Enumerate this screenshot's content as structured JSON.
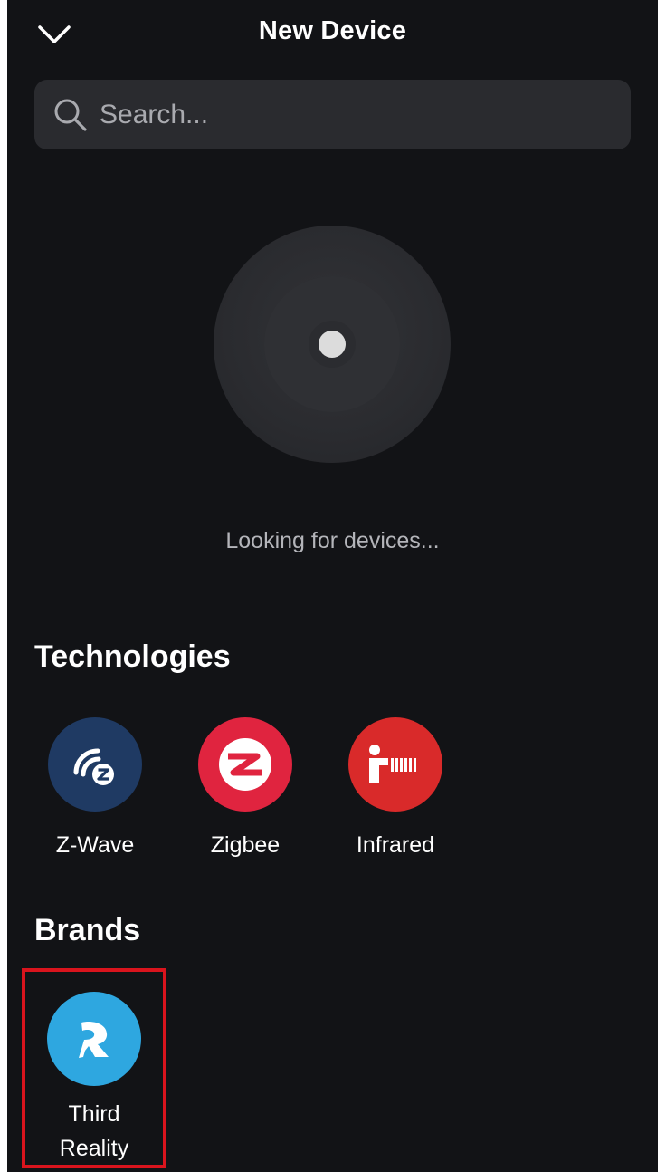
{
  "header": {
    "title": "New Device"
  },
  "search": {
    "placeholder": "Search..."
  },
  "scan": {
    "status_text": "Looking for devices..."
  },
  "technologies": {
    "title": "Technologies",
    "items": [
      {
        "label": "Z-Wave",
        "icon": "zwave-icon",
        "color": "#1f3a63"
      },
      {
        "label": "Zigbee",
        "icon": "zigbee-icon",
        "color": "#e0243f"
      },
      {
        "label": "Infrared",
        "icon": "infrared-icon",
        "color": "#d92a2a"
      }
    ]
  },
  "brands": {
    "title": "Brands",
    "items": [
      {
        "label": "Third Reality",
        "icon": "third-reality-logo-icon",
        "color": "#2ea7e0"
      }
    ]
  },
  "colors": {
    "background": "#121316",
    "search_field": "#2a2b2f",
    "selection_outline": "#d9141d"
  }
}
